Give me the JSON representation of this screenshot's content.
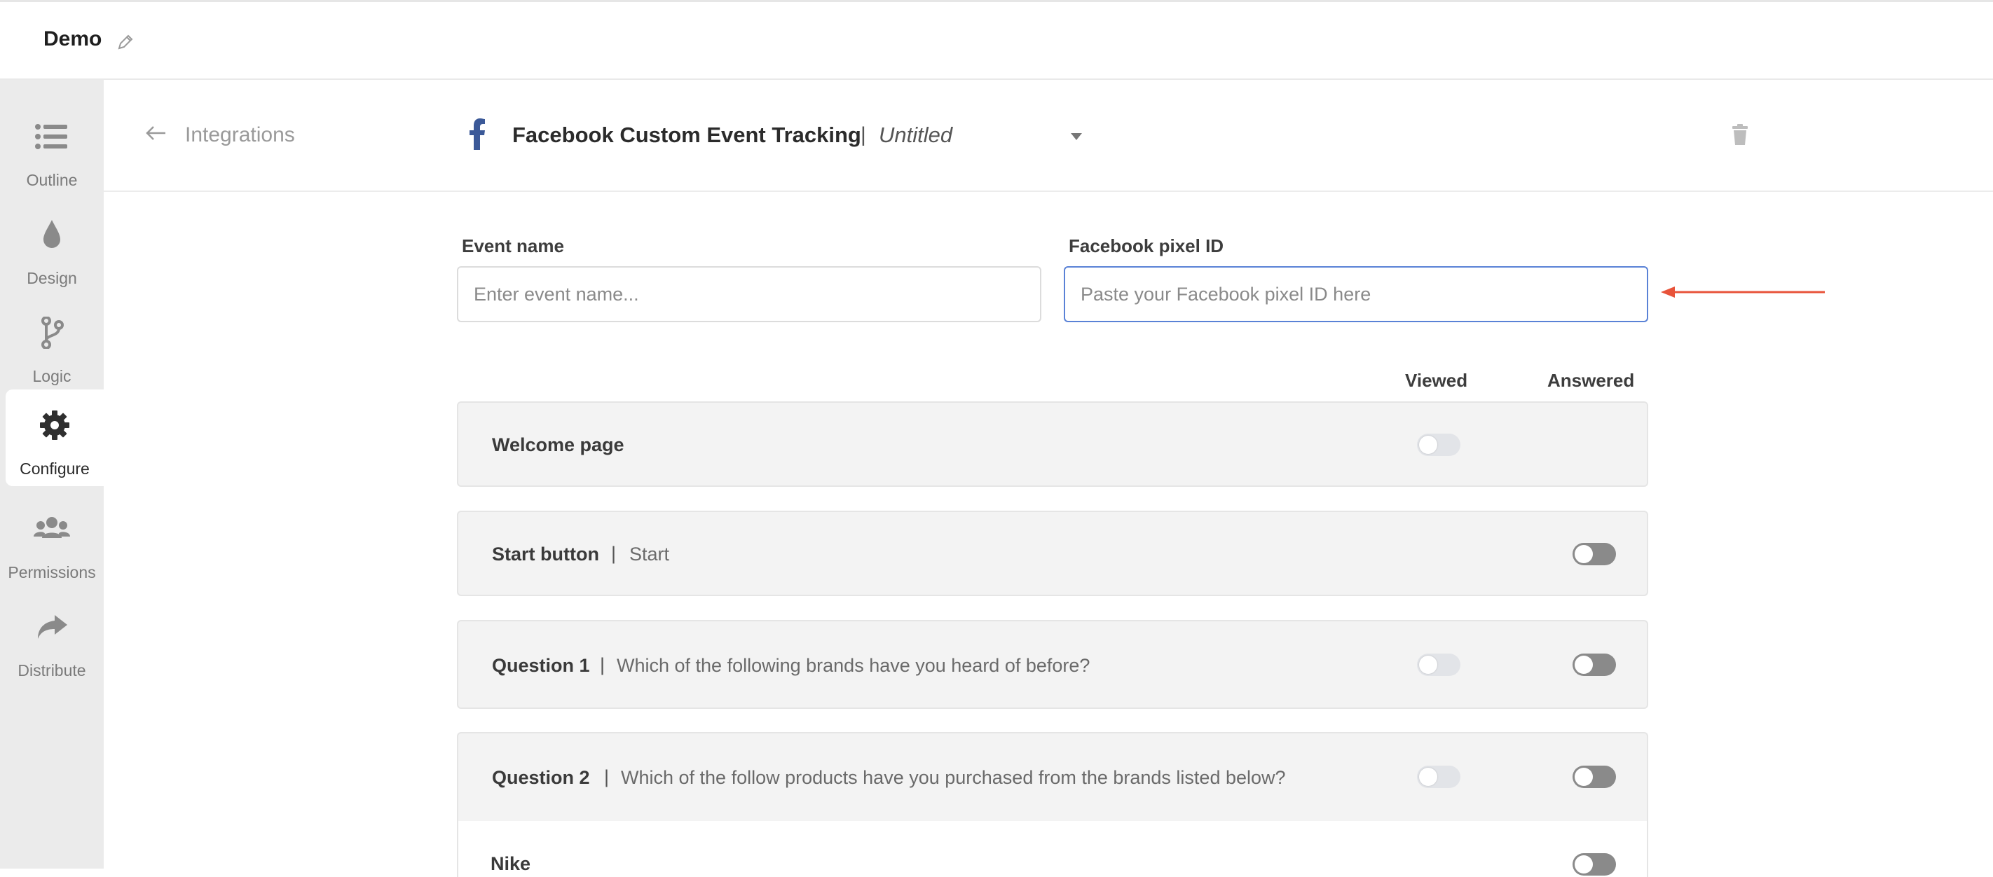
{
  "app": {
    "form_title": "Demo"
  },
  "sidebar": {
    "items": [
      {
        "label": "Outline",
        "icon": "list-icon"
      },
      {
        "label": "Design",
        "icon": "droplet-icon"
      },
      {
        "label": "Logic",
        "icon": "branch-icon"
      },
      {
        "label": "Configure",
        "icon": "gear-icon",
        "active": true
      },
      {
        "label": "Permissions",
        "icon": "users-icon"
      },
      {
        "label": "Distribute",
        "icon": "share-icon"
      }
    ]
  },
  "header": {
    "back_label": "Integrations",
    "integration_title": "Facebook Custom Event Tracking",
    "separator": "|",
    "config_name": "Untitled"
  },
  "form": {
    "event_name_label": "Event name",
    "event_name_placeholder": "Enter event name...",
    "event_name_value": "",
    "pixel_id_label": "Facebook pixel ID",
    "pixel_id_placeholder": "Paste your Facebook pixel ID here",
    "pixel_id_value": ""
  },
  "columns": {
    "viewed": "Viewed",
    "answered": "Answered"
  },
  "rows": [
    {
      "title": "Welcome page",
      "desc": "",
      "viewed": "disabled",
      "answered": null
    },
    {
      "title": "Start button",
      "desc": "Start",
      "viewed": null,
      "answered": "off"
    },
    {
      "title": "Question 1",
      "desc": "Which of the following brands have you heard of before?",
      "viewed": "disabled",
      "answered": "off"
    },
    {
      "title": "Question 2",
      "desc": "Which of the follow products have you purchased from the brands listed below?",
      "viewed": "disabled",
      "answered": "off"
    },
    {
      "title": "Nike",
      "desc": "",
      "viewed": null,
      "answered": "off"
    }
  ],
  "colors": {
    "accent_blue": "#5a82d6",
    "facebook_blue": "#3b5998",
    "annotation_arrow": "#e8533a",
    "sidebar_bg": "#ebebeb",
    "row_bg": "#f3f3f3"
  }
}
